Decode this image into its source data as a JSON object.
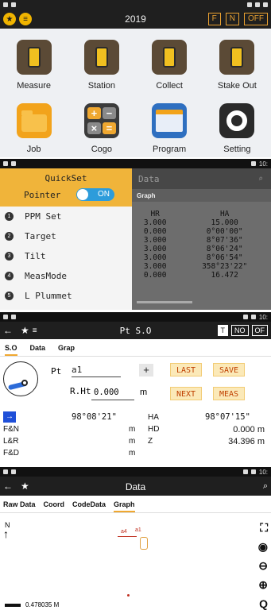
{
  "panel1": {
    "year": "2019",
    "fn_buttons": [
      "F",
      "N",
      "OFF"
    ],
    "tiles": [
      {
        "label": "Measure"
      },
      {
        "label": "Station"
      },
      {
        "label": "Collect"
      },
      {
        "label": "Stake Out"
      },
      {
        "label": "Job"
      },
      {
        "label": "Cogo"
      },
      {
        "label": "Program"
      },
      {
        "label": "Setting"
      }
    ],
    "cogo_keys": [
      "+",
      "−",
      "×",
      "="
    ]
  },
  "panel2": {
    "status_time": "10:",
    "quickset_title": "QuickSet",
    "pointer_label": "Pointer",
    "toggle_label": "ON",
    "items": [
      {
        "num": "1",
        "label": "PPM Set"
      },
      {
        "num": "2",
        "label": "Target"
      },
      {
        "num": "3",
        "label": "Tilt"
      },
      {
        "num": "4",
        "label": "MeasMode"
      },
      {
        "num": "5",
        "label": "L Plummet"
      }
    ],
    "data_title": "Data",
    "graph_tab": "Graph",
    "columns": [
      "HR",
      "HA"
    ],
    "rows": [
      [
        "3.000",
        "15.000"
      ],
      [
        "0.000",
        "0°00'00\""
      ],
      [
        "3.000",
        "8°07'36\""
      ],
      [
        "3.000",
        "8°06'24\""
      ],
      [
        "3.000",
        "8°06'54\""
      ],
      [
        "3.000",
        "358°23'22\""
      ],
      [
        "0.000",
        "16.472"
      ]
    ]
  },
  "panel3": {
    "title": "Pt S.O",
    "buttons": [
      "T",
      "NO",
      "OF"
    ],
    "tabs": [
      "S.O",
      "Data",
      "Grap"
    ],
    "pt_label": "Pt",
    "pt_value": "a1",
    "plus": "+",
    "last": "LAST",
    "save": "SAVE",
    "next": "NEXT",
    "meas": "MEAS",
    "rht_label": "R.Ht",
    "rht_value": "0.000",
    "rht_unit": "m",
    "angle_left": "98°08'21\"",
    "ha_label": "HA",
    "angle_right": "98°07'15\"",
    "fn_label": "F&N",
    "fn_unit": "m",
    "hd_label": "HD",
    "hd_value": "0.000 m",
    "lr_label": "L&R",
    "lr_unit": "m",
    "z_label": "Z",
    "z_value": "34.396 m",
    "fd_label": "F&D",
    "fd_unit": "m"
  },
  "panel4": {
    "title": "Data",
    "tabs": [
      "Raw Data",
      "Coord",
      "CodeData",
      "Graph"
    ],
    "north_label": "N",
    "point_labels": [
      "a4",
      "a1"
    ],
    "scale_label": "0.478035 M"
  },
  "colors": {
    "accent": "#f0a830",
    "brand_blue": "#2d9cdb",
    "dark": "#1f1f1f"
  }
}
